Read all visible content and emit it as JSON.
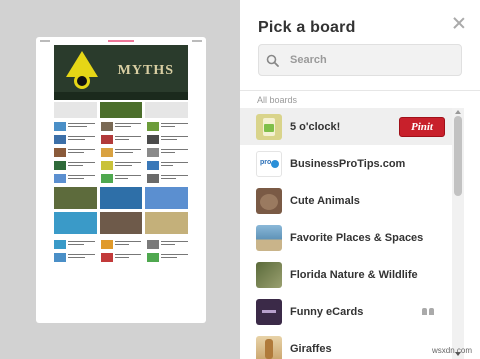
{
  "dialog": {
    "title": "Pick a board",
    "close_icon": "close-icon"
  },
  "preview": {
    "hero_text": "MYTHS"
  },
  "search": {
    "placeholder": "Search",
    "value": ""
  },
  "boards": {
    "section_label": "All boards",
    "items": [
      {
        "name": "5 o'clock!",
        "selected": true,
        "thumb_color": "#d9d48b"
      },
      {
        "name": "BusinessProTips.com",
        "selected": false,
        "thumb_color": "#ffffff"
      },
      {
        "name": "Cute Animals",
        "selected": false,
        "thumb_color": "#7a5a45"
      },
      {
        "name": "Favorite Places & Spaces",
        "selected": false,
        "thumb_color": "#6f9ab8"
      },
      {
        "name": "Florida Nature & Wildlife",
        "selected": false,
        "thumb_color": "#6c7a4a"
      },
      {
        "name": "Funny eCards",
        "selected": false,
        "thumb_color": "#3b2a48",
        "group": true
      },
      {
        "name": "Giraffes",
        "selected": false,
        "thumb_color": "#c9a36a"
      }
    ],
    "pin_label": "Pinit"
  },
  "colors": {
    "pin_button": "#c8202b",
    "panel_bg": "#ffffff",
    "overlay_bg": "#d2d2d2"
  },
  "watermark": "wsxdn.com"
}
